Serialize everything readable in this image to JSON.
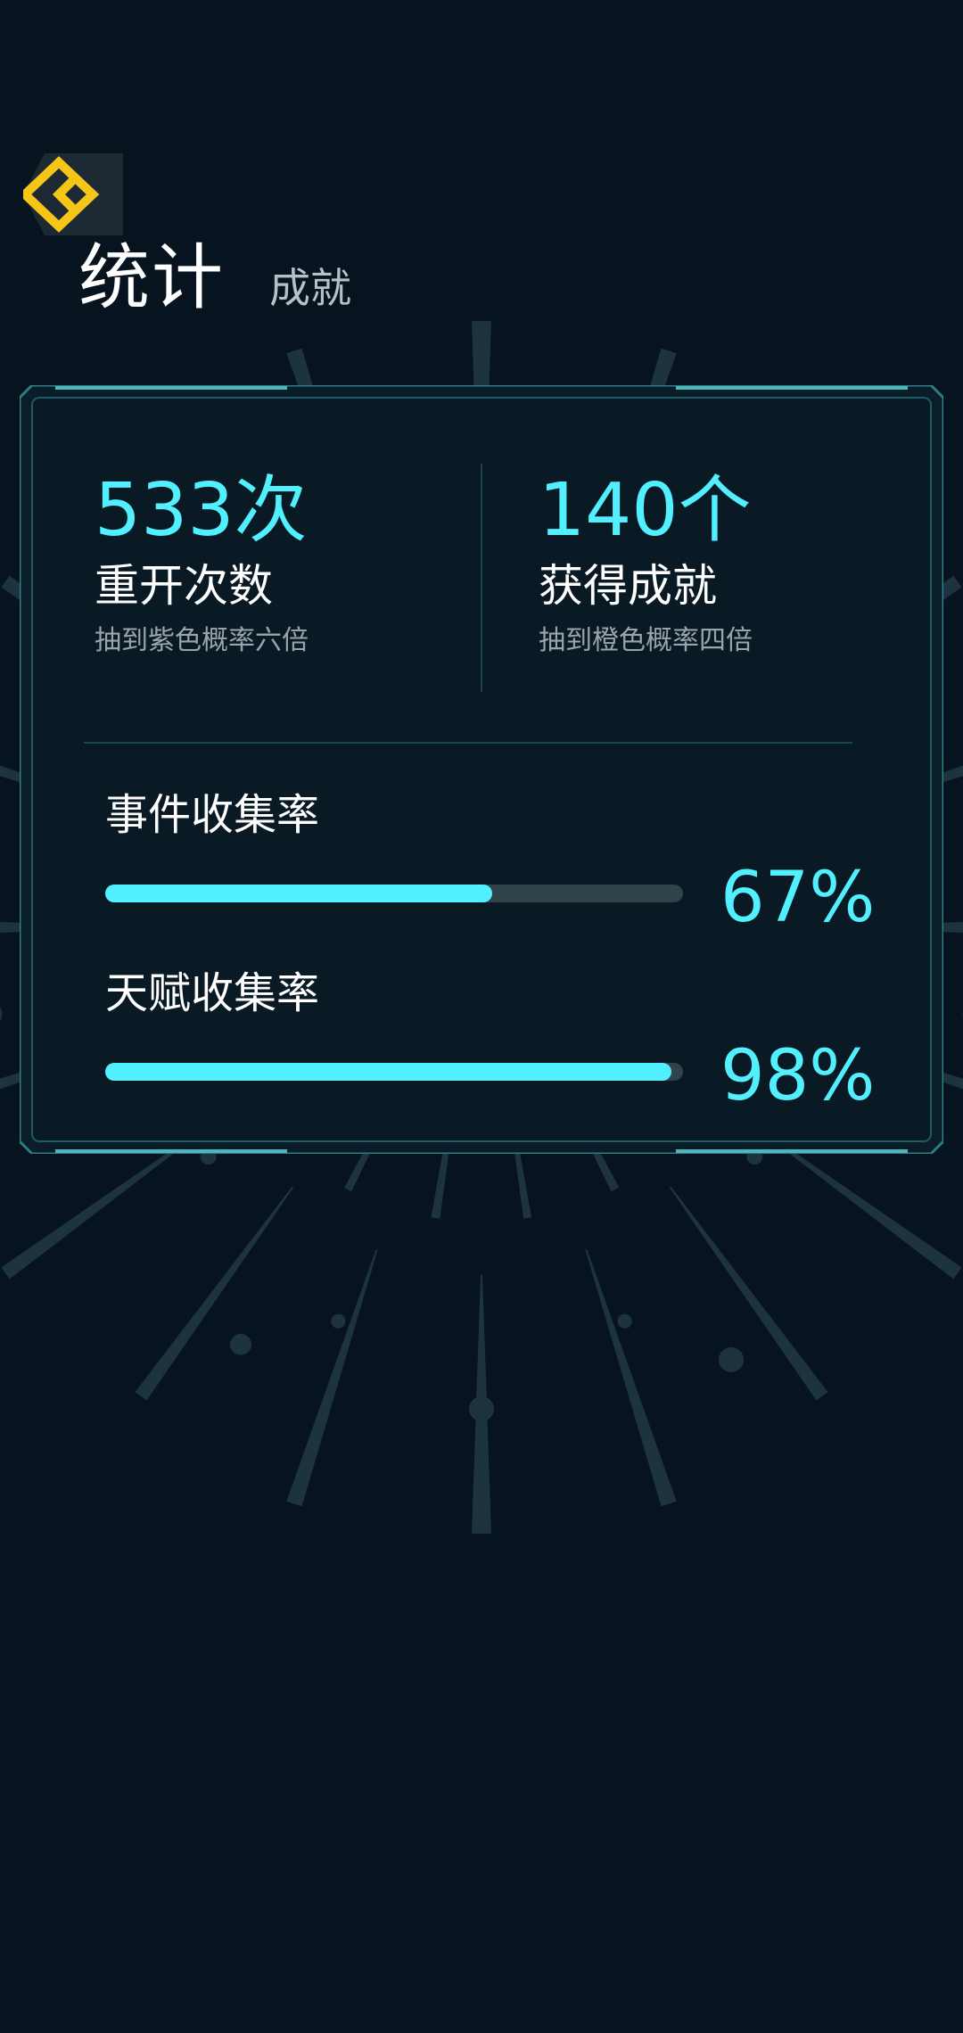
{
  "header": {
    "back_icon": "back-chevron-icon",
    "tabs": [
      {
        "label": "统计",
        "active": true
      },
      {
        "label": "成就",
        "active": false
      }
    ]
  },
  "stats": [
    {
      "value": "533次",
      "label": "重开次数",
      "sub": "抽到紫色概率六倍"
    },
    {
      "value": "140个",
      "label": "获得成就",
      "sub": "抽到橙色概率四倍"
    }
  ],
  "rates": [
    {
      "label": "事件收集率",
      "percent_text": "67%",
      "fraction": 0.67
    },
    {
      "label": "天赋收集率",
      "percent_text": "98%",
      "fraction": 0.98
    }
  ],
  "colors": {
    "background": "#07131f",
    "accent": "#52f0ff",
    "back_icon": "#f5c518",
    "track": "#30444c",
    "panel_border": "#2a7f86"
  }
}
